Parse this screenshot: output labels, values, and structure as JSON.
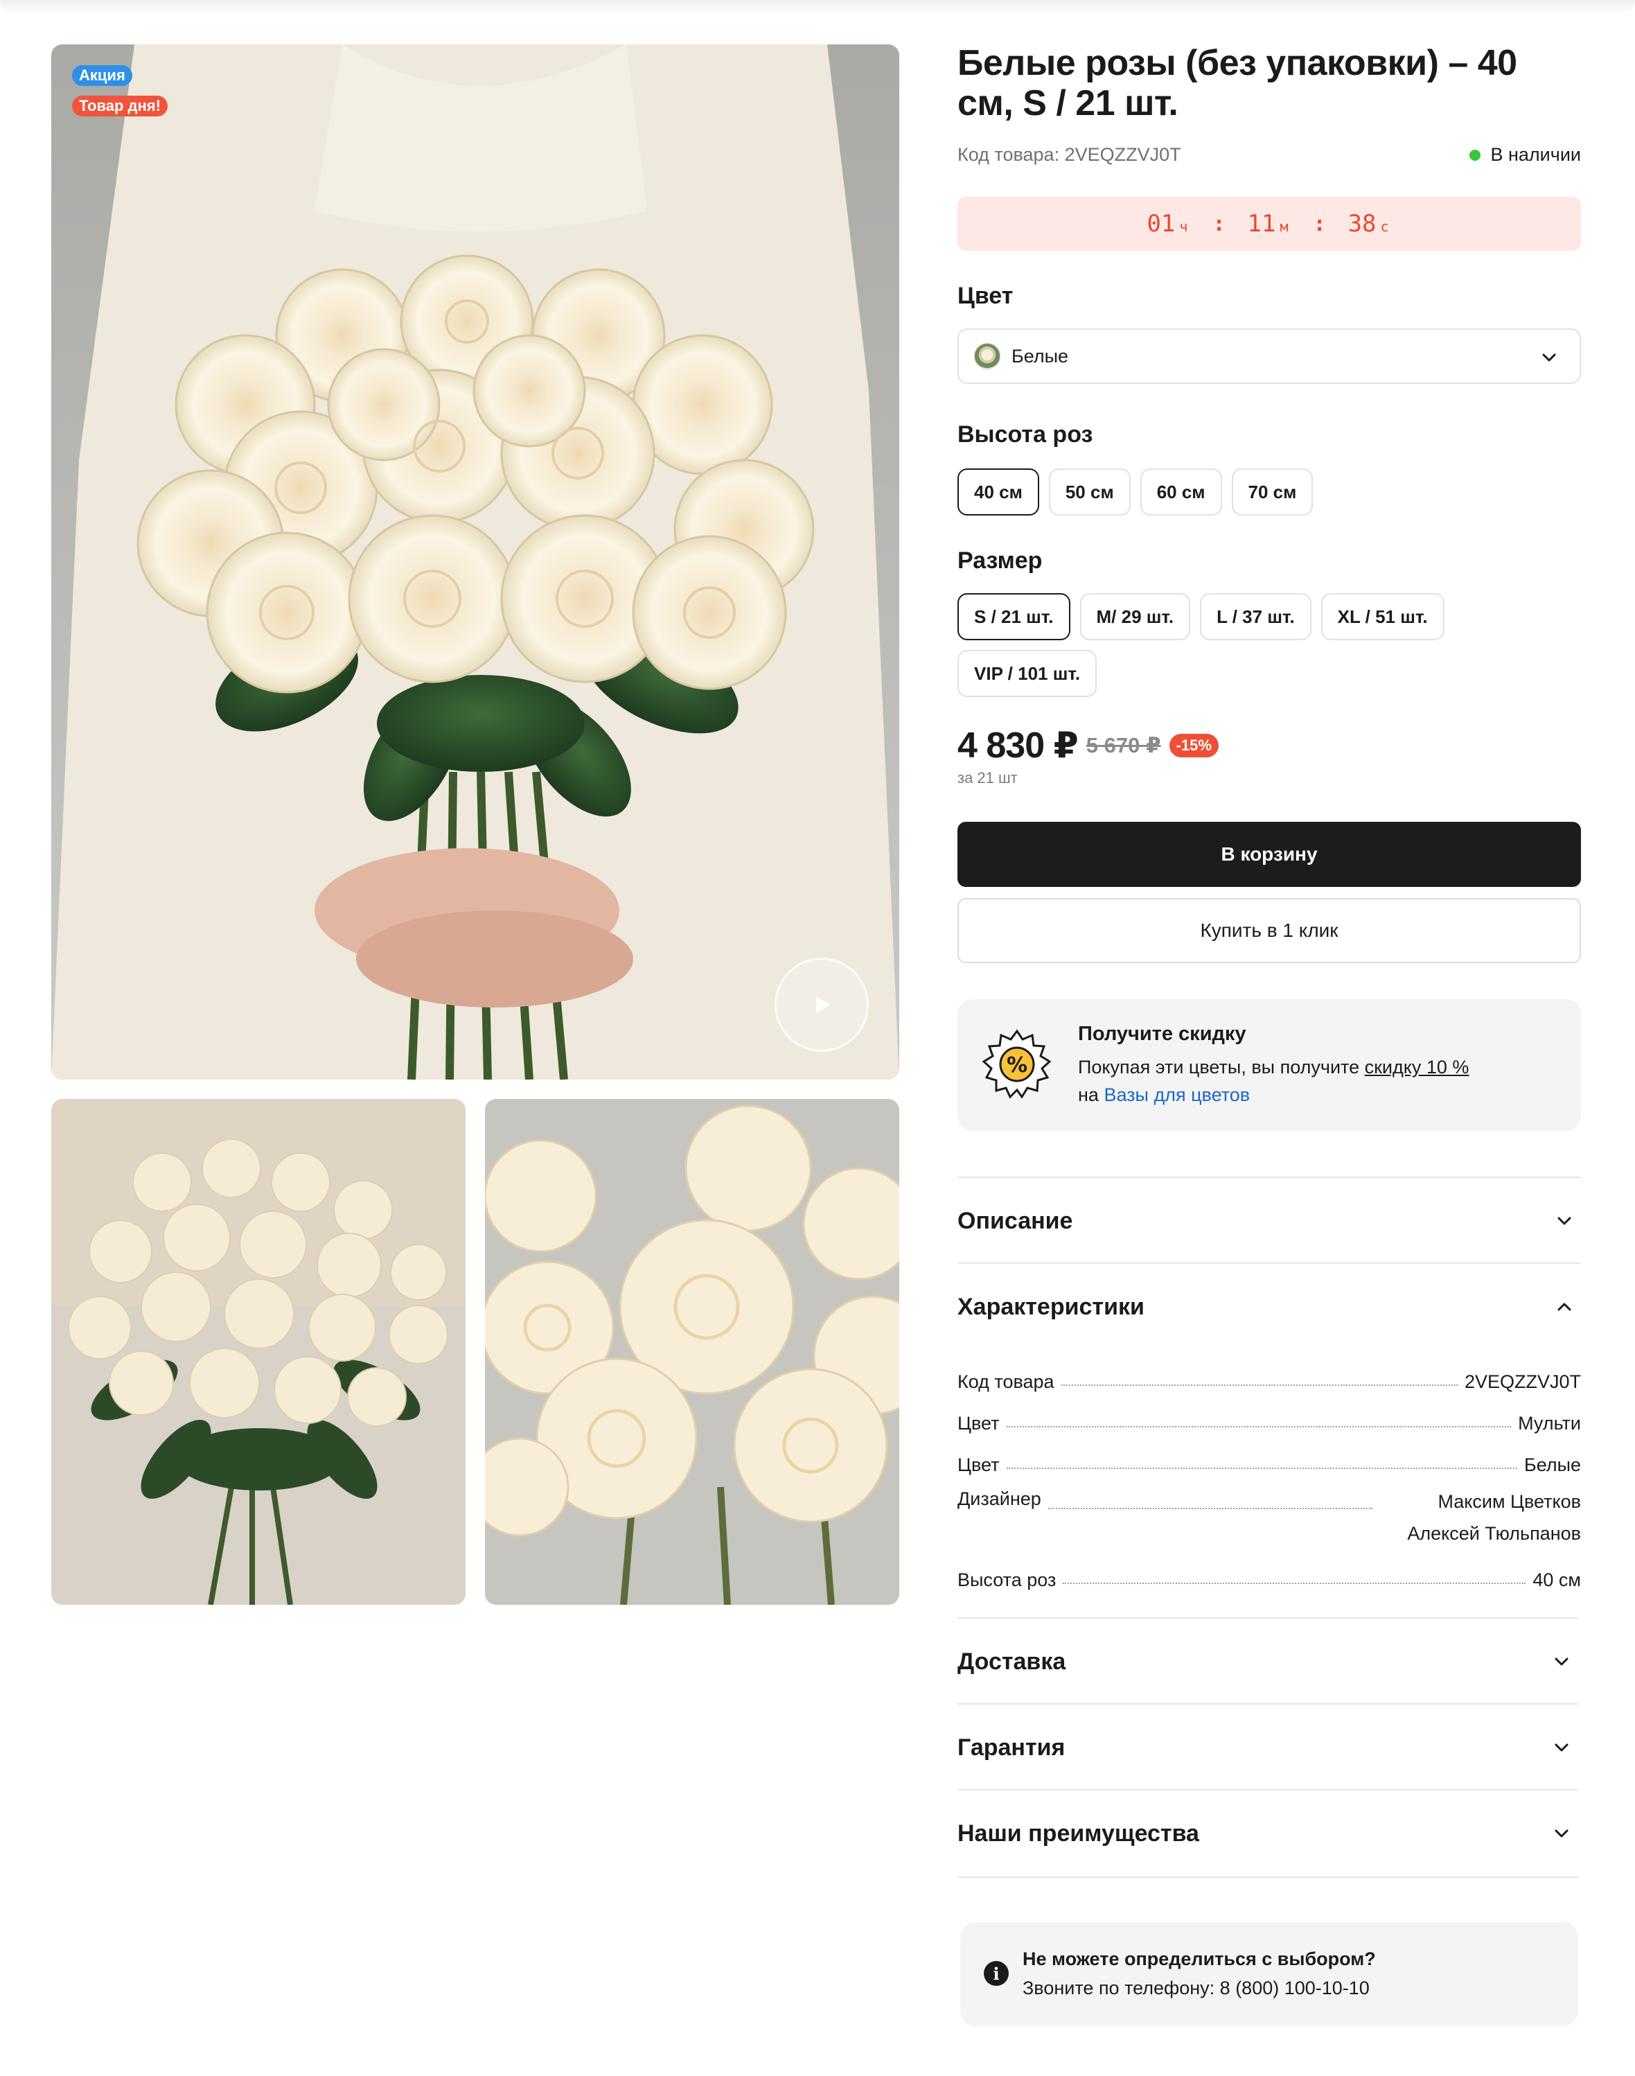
{
  "gallery": {
    "badges": {
      "sale": "Акция",
      "day": "Товар дня!"
    }
  },
  "product": {
    "title": "Белые розы (без упаковки) – 40 см, S / 21 шт.",
    "sku_label": "Код товара: 2VEQZZVJ0T",
    "stock": "В наличии"
  },
  "timer": {
    "h": "01",
    "h_unit": "ч",
    "m": "11",
    "m_unit": "м",
    "s": "38",
    "s_unit": "с"
  },
  "color": {
    "label": "Цвет",
    "selected": "Белые"
  },
  "heights": {
    "label": "Высота роз",
    "options": [
      "40 см",
      "50 см",
      "60 см",
      "70 см"
    ],
    "selected_index": 0
  },
  "sizes": {
    "label": "Размер",
    "options": [
      "S / 21 шт.",
      "M/ 29 шт.",
      "L / 37 шт.",
      "XL / 51 шт.",
      "VIP / 101 шт."
    ],
    "selected_index": 0
  },
  "pricing": {
    "price": "4 830 ₽",
    "old_price": "5 670 ₽",
    "discount": "-15%",
    "per": "за 21 шт"
  },
  "actions": {
    "cart": "В корзину",
    "one_click": "Купить в 1 клик"
  },
  "promo": {
    "title": "Получите скидку",
    "text_before": "Покупая эти цветы, вы получите ",
    "discount_link": "скидку 10 %",
    "text_on": "на ",
    "category_link": "Вазы для цветов"
  },
  "accordions": {
    "description": "Описание",
    "specs": "Характеристики",
    "delivery": "Доставка",
    "warranty": "Гарантия",
    "advantages": "Наши преимущества"
  },
  "specs": [
    {
      "key": "Код товара",
      "value": "2VEQZZVJ0T"
    },
    {
      "key": "Цвет",
      "value": "Мульти"
    },
    {
      "key": "Цвет",
      "value": "Белые"
    },
    {
      "key": "Дизайнер",
      "value": "Максим Цветков",
      "value2": "Алексей Тюльпанов"
    },
    {
      "key": "Высота роз",
      "value": "40 см"
    }
  ],
  "help": {
    "title": "Не можете определиться с выбором?",
    "text": "Звоните по телефону: 8 (800) 100-10-10"
  },
  "colors": {
    "accent": "#ea4a2e",
    "sale_badge": "#2f8fe8",
    "day_badge": "#f0553c",
    "stock_dot": "#3cc63c",
    "link": "#1b67c9"
  }
}
